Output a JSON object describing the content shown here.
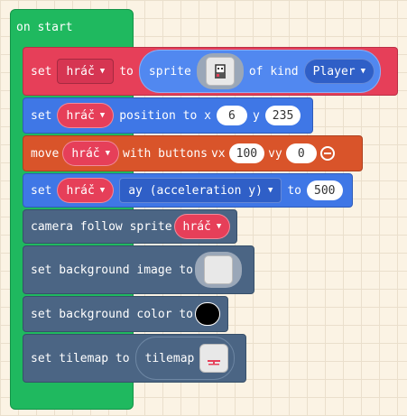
{
  "hat": {
    "label": "on start"
  },
  "blocks": {
    "set_sprite": {
      "set": "set",
      "var": "hráč",
      "to": "to",
      "sprite": "sprite",
      "of_kind": "of kind",
      "kind": "Player"
    },
    "set_position": {
      "set": "set",
      "var": "hráč",
      "position_to_x": "position to x",
      "x": "6",
      "y_label": "y",
      "y": "235"
    },
    "move": {
      "move": "move",
      "var": "hráč",
      "with_buttons": "with buttons",
      "vx_label": "vx",
      "vx": "100",
      "vy_label": "vy",
      "vy": "0"
    },
    "set_accel": {
      "set": "set",
      "var": "hráč",
      "property": "ay (acceleration y)",
      "to": "to",
      "value": "500"
    },
    "camera": {
      "label": "camera follow sprite",
      "var": "hráč"
    },
    "bg_image": {
      "label": "set background image to"
    },
    "bg_color": {
      "label": "set background color to",
      "color": "#000000"
    },
    "tilemap": {
      "label": "set tilemap to",
      "tilemap": "tilemap"
    }
  },
  "icons": {
    "dropdown": "caret-down-icon",
    "remove": "minus-circle-icon",
    "sprite": "sprite-image-icon",
    "tilemap": "tilemap-image-icon"
  },
  "colors": {
    "hat": "#1fb95f",
    "sprites": "#e63f59",
    "position": "#3f77e6",
    "controller": "#d9542a",
    "scene": "#4b6584",
    "background": "#fbf3e4"
  }
}
